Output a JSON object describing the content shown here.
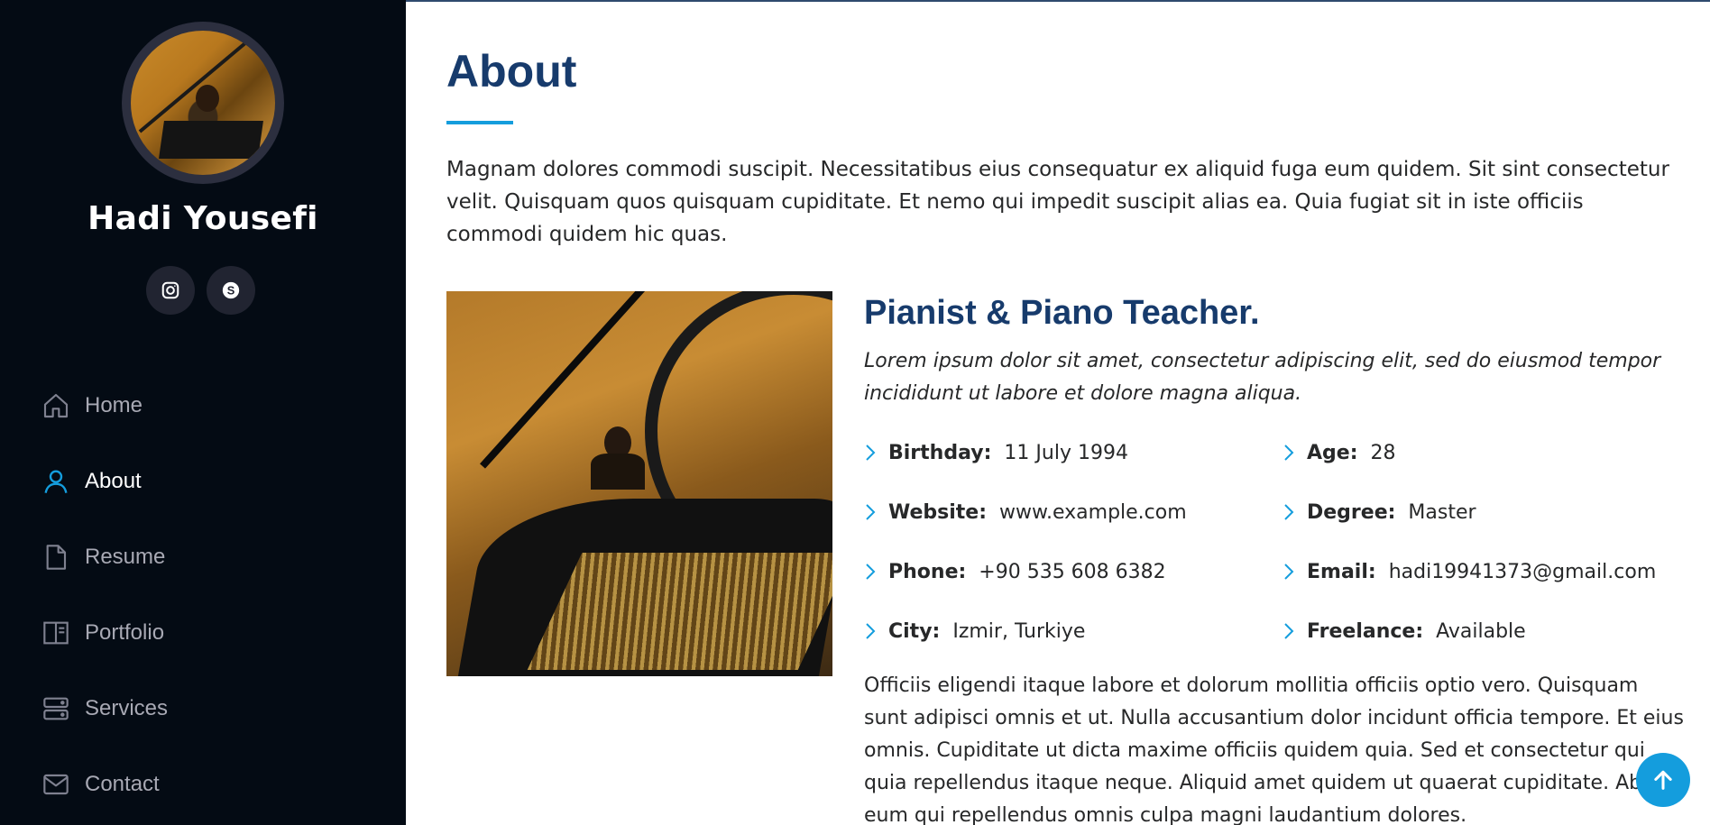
{
  "profile": {
    "name": "Hadi Yousefi"
  },
  "social": [
    {
      "icon": "instagram-icon"
    },
    {
      "icon": "skype-icon"
    }
  ],
  "nav": {
    "items": [
      {
        "label": "Home",
        "icon": "house-icon",
        "active": false
      },
      {
        "label": "About",
        "icon": "person-icon",
        "active": true
      },
      {
        "label": "Resume",
        "icon": "file-icon",
        "active": false
      },
      {
        "label": "Portfolio",
        "icon": "portfolio-icon",
        "active": false
      },
      {
        "label": "Services",
        "icon": "server-icon",
        "active": false
      },
      {
        "label": "Contact",
        "icon": "envelope-icon",
        "active": false
      }
    ]
  },
  "about": {
    "title": "About",
    "intro": "Magnam dolores commodi suscipit. Necessitatibus eius consequatur ex aliquid fuga eum quidem. Sit sint consectetur velit. Quisquam quos quisquam cupiditate. Et nemo qui impedit suscipit alias ea. Quia fugiat sit in iste officiis commodi quidem hic quas.",
    "role": "Pianist & Piano Teacher.",
    "tagline": "Lorem ipsum dolor sit amet, consectetur adipiscing elit, sed do eiusmod tempor incididunt ut labore et dolore magna aliqua.",
    "facts": [
      {
        "label": "Birthday:",
        "value": "11 July 1994"
      },
      {
        "label": "Age:",
        "value": "28"
      },
      {
        "label": "Website:",
        "value": "www.example.com"
      },
      {
        "label": "Degree:",
        "value": "Master"
      },
      {
        "label": "Phone:",
        "value": "+90 535 608 6382"
      },
      {
        "label": "Email:",
        "value": "hadi19941373@gmail.com"
      },
      {
        "label": "City:",
        "value": "Izmir, Turkiye"
      },
      {
        "label": "Freelance:",
        "value": "Available"
      }
    ],
    "outro": "Officiis eligendi itaque labore et dolorum mollitia officiis optio vero. Quisquam sunt adipisci omnis et ut. Nulla accusantium dolor incidunt officia tempore. Et eius omnis. Cupiditate ut dicta maxime officiis quidem quia. Sed et consectetur qui quia repellendus itaque neque. Aliquid amet quidem ut quaerat cupiditate. Ab et eum qui repellendus omnis culpa magni laudantium dolores."
  },
  "colors": {
    "sidebar_bg": "#040b14",
    "accent": "#149ddd",
    "heading": "#173b6c"
  },
  "back_to_top_icon": "arrow-up-icon"
}
